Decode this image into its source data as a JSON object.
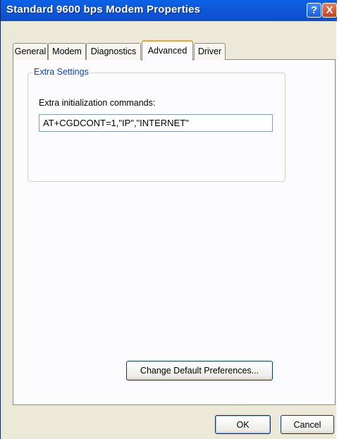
{
  "window": {
    "title": "Standard  9600 bps Modem Properties",
    "help_glyph": "?",
    "close_glyph": "X"
  },
  "tabs": [
    {
      "label": "General",
      "active": false
    },
    {
      "label": "Modem",
      "active": false
    },
    {
      "label": "Diagnostics",
      "active": false
    },
    {
      "label": "Advanced",
      "active": true
    },
    {
      "label": "Driver",
      "active": false
    }
  ],
  "extra_settings": {
    "group_label": "Extra Settings",
    "field_label": "Extra initialization commands:",
    "field_value": "AT+CGDCONT=1,\"IP\",\"INTERNET\""
  },
  "buttons": {
    "change_defaults": "Change Default Preferences...",
    "ok": "OK",
    "cancel": "Cancel"
  },
  "colors": {
    "titlebar": "#0b55d8",
    "group_label": "#0046d5",
    "active_tab_accent": "#f2a530"
  }
}
